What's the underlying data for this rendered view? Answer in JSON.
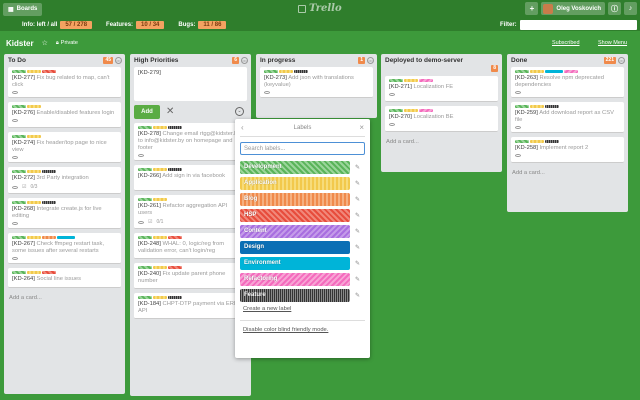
{
  "header": {
    "boards_label": "Boards",
    "logo_text": "Trello",
    "user_name": "Oleg Voskovich"
  },
  "stats": {
    "info_label": "Info: left / all",
    "info_value": "57 / 278",
    "features_label": "Features:",
    "features_value": "10 / 34",
    "bugs_label": "Bugs:",
    "bugs_value": "11 / 86",
    "filter_label": "Filter:"
  },
  "board": {
    "title": "Kidster",
    "privacy": "Private",
    "subscribed": "Subscribed",
    "show_menu": "Show Menu"
  },
  "colors": {
    "board_bg": "#3d9a3b",
    "header_bg": "#2f7e2c",
    "add_button": "#5aac44"
  },
  "lists": {
    "todo": {
      "name": "To Do",
      "count": "45",
      "add": "Add a card...",
      "cards": [
        {
          "id": "[KD-277]",
          "text": "Fix bug related to map, can't click"
        },
        {
          "id": "[KD-276]",
          "text": "Enable/disabled features login"
        },
        {
          "id": "[KD-274]",
          "text": "Fix header/top page to nice view"
        },
        {
          "id": "[KD-272]",
          "text": "3rd Party integration",
          "checklist": "0/3"
        },
        {
          "id": "[KD-268]",
          "text": "Integrate create.js for live editing"
        },
        {
          "id": "[KD-267]",
          "text": "Check ffmpeg restart task, some issues after several restarts"
        },
        {
          "id": "[KD-264]",
          "text": "Social line issues"
        }
      ]
    },
    "high": {
      "name": "High Priorities",
      "count": "6",
      "compose_text": "[KD-279]",
      "add_button": "Add",
      "cards": [
        {
          "id": "[KD-278]",
          "text": "Change email rtgg@kidster.by to info@kidster.by on homepage and footer"
        },
        {
          "id": "[KD-266]",
          "text": "Add sign in via facebook"
        },
        {
          "id": "[KD-261]",
          "text": "Refactor aggregation API users",
          "checklist": "0/1"
        },
        {
          "id": "[KD-248]",
          "text": "WHAL: 0, logic/reg from validation error, can't login/reg"
        },
        {
          "id": "[KD-240]",
          "text": "Fix update parent phone number"
        },
        {
          "id": "[KD-184]",
          "text": "CHPT-DTP payment via ERIP-API"
        }
      ]
    },
    "progress": {
      "name": "In progress",
      "count": "1",
      "cards": [
        {
          "id": "[KD-273]",
          "text": "Add json with translations (keyvalue)"
        }
      ]
    },
    "deployed": {
      "name": "Deployed to demo-server",
      "count": "8",
      "add": "Add a card...",
      "cards": [
        {
          "id": "[KD-271]",
          "text": "Localization FE"
        },
        {
          "id": "[KD-270]",
          "text": "Localization BE"
        }
      ]
    },
    "done": {
      "name": "Done",
      "count": "221",
      "add": "Add a card...",
      "cards": [
        {
          "id": "[KD-263]",
          "text": "Resolve npm deprecated dependencies"
        },
        {
          "id": "[KD-259]",
          "text": "Add download report as CSV file"
        },
        {
          "id": "[KD-258]",
          "text": "Implement report 2"
        }
      ]
    }
  },
  "popover": {
    "title": "Labels",
    "search_placeholder": "Search labels...",
    "labels": [
      "Development",
      "Application",
      "Blog",
      "HSP",
      "Content",
      "Design",
      "Environment",
      "Refactoring",
      "Feature"
    ],
    "create_link": "Create a new label",
    "colorblind_link": "Disable color blind friendly mode."
  }
}
